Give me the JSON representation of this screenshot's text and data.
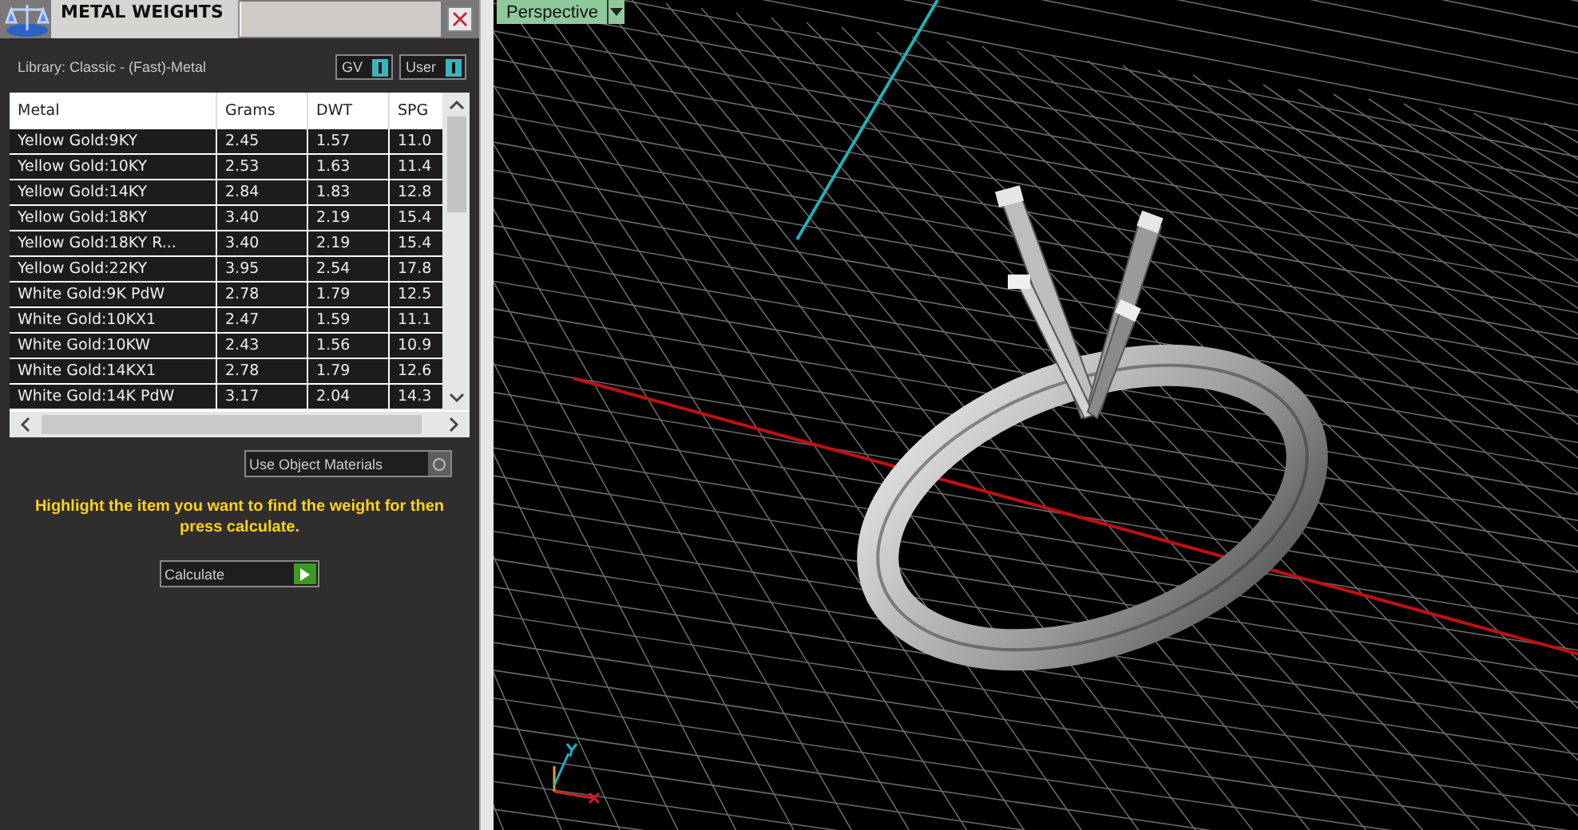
{
  "panel": {
    "title": "METAL WEIGHTS",
    "library": "Library: Classic - (Fast)-Metal",
    "toggles": [
      {
        "label": "GV",
        "on": true
      },
      {
        "label": "User",
        "on": true
      }
    ]
  },
  "table": {
    "columns": [
      "Metal",
      "Grams",
      "DWT",
      "SPG"
    ],
    "rows": [
      [
        "Yellow Gold:9KY",
        "2.45",
        "1.57",
        "11.0"
      ],
      [
        "Yellow Gold:10KY",
        "2.53",
        "1.63",
        "11.4"
      ],
      [
        "Yellow Gold:14KY",
        "2.84",
        "1.83",
        "12.8"
      ],
      [
        "Yellow Gold:18KY",
        "3.40",
        "2.19",
        "15.4"
      ],
      [
        "Yellow Gold:18KY R...",
        "3.40",
        "2.19",
        "15.4"
      ],
      [
        "Yellow Gold:22KY",
        "3.95",
        "2.54",
        "17.8"
      ],
      [
        "White Gold:9K PdW",
        "2.78",
        "1.79",
        "12.5"
      ],
      [
        "White Gold:10KX1",
        "2.47",
        "1.59",
        "11.1"
      ],
      [
        "White Gold:10KW",
        "2.43",
        "1.56",
        "10.9"
      ],
      [
        "White Gold:14KX1",
        "2.78",
        "1.79",
        "12.6"
      ],
      [
        "White Gold:14K PdW",
        "3.17",
        "2.04",
        "14.3"
      ]
    ]
  },
  "use_object_materials": {
    "label": "Use Object Materials",
    "on": false
  },
  "hint": "Highlight the item you want to find the weight for then press calculate.",
  "calculate_button": "Calculate",
  "viewport": {
    "view_label": "Perspective"
  }
}
